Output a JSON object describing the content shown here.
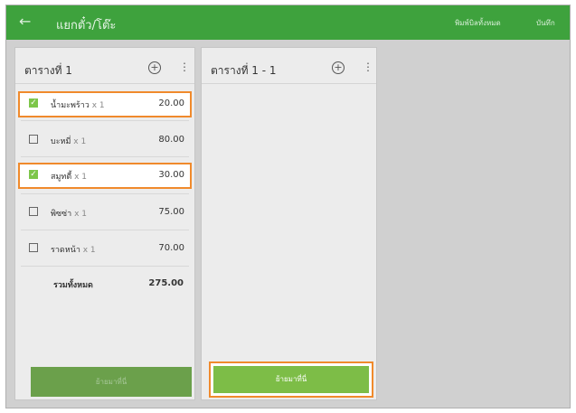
{
  "topbar": {
    "title": "แยกตั๋ว/โต๊ะ",
    "print_all": "พิมพ์บิลทั้งหมด",
    "save": "บันทึก"
  },
  "left_table": {
    "title": "ตารางที่ 1",
    "items": [
      {
        "name": "น้ำมะพร้าว",
        "qty": "x 1",
        "price": "20.00",
        "checked": true
      },
      {
        "name": "บะหมี่",
        "qty": "x 1",
        "price": "80.00",
        "checked": false
      },
      {
        "name": "สมูทตี้",
        "qty": "x 1",
        "price": "30.00",
        "checked": true
      },
      {
        "name": "พิซซ่า",
        "qty": "x 1",
        "price": "75.00",
        "checked": false
      },
      {
        "name": "ราดหน้า",
        "qty": "x 1",
        "price": "70.00",
        "checked": false
      }
    ],
    "total_label": "รวมทั้งหมด",
    "total_value": "275.00",
    "move_button": "ย้ายมาที่นี่"
  },
  "right_table": {
    "title": "ตารางที่ 1 - 1",
    "move_button": "ย้ายมาที่นี่"
  },
  "icons": {
    "back": "arrow-back-icon",
    "add": "plus-circle-icon",
    "menu": "kebab-menu-icon",
    "check": "check-icon"
  },
  "colors": {
    "topbar": "#3ea23d",
    "accent_green": "#7dbd47",
    "highlight_orange": "#f08a2c"
  }
}
